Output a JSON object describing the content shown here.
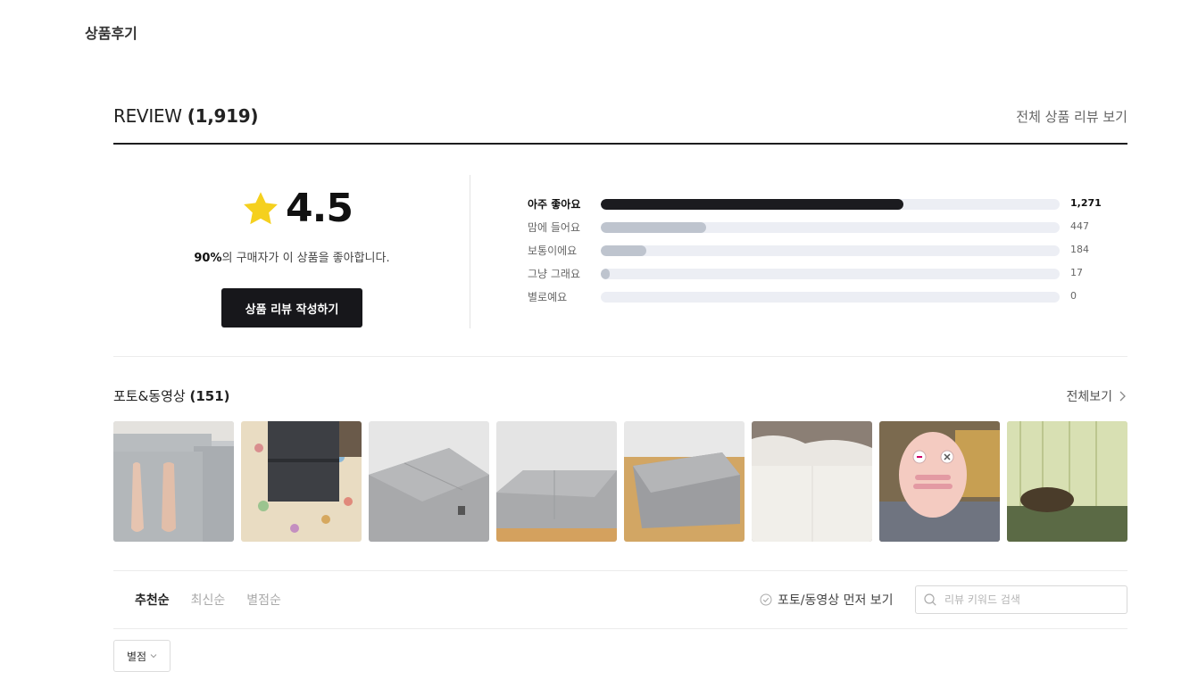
{
  "section_title": "상품후기",
  "review": {
    "title": "REVIEW",
    "count": "(1,919)",
    "all_link": "전체 상품 리뷰 보기"
  },
  "summary": {
    "score": "4.5",
    "percent": "90%",
    "satisfaction_text": "의 구매자가 이 상품을 좋아합니다.",
    "write_button": "상품 리뷰 작성하기",
    "star_color": "#f5d01e"
  },
  "distribution": [
    {
      "label": "아주 좋아요",
      "count": "1,271",
      "fraction": 0.66
    },
    {
      "label": "맘에 들어요",
      "count": "447",
      "fraction": 0.23
    },
    {
      "label": "보통이에요",
      "count": "184",
      "fraction": 0.1
    },
    {
      "label": "그냥 그래요",
      "count": "17",
      "fraction": 0.02
    },
    {
      "label": "별로예요",
      "count": "0",
      "fraction": 0.0
    }
  ],
  "photos": {
    "title": "포토&동영상",
    "count": "(151)",
    "all_link": "전체보기",
    "items": [
      {
        "name": "photo-legs-on-mattress"
      },
      {
        "name": "photo-folded-mattress-on-mat"
      },
      {
        "name": "photo-gray-mattress-1"
      },
      {
        "name": "photo-gray-mattress-2"
      },
      {
        "name": "photo-gray-mattress-3"
      },
      {
        "name": "photo-white-mattress"
      },
      {
        "name": "photo-person-on-pillow"
      },
      {
        "name": "photo-green-mattress-pillow"
      }
    ]
  },
  "sort": {
    "tabs": [
      "추천순",
      "최신순",
      "별점순"
    ],
    "active": 0,
    "photo_first": "포토/동영상 먼저 보기"
  },
  "search": {
    "placeholder": "리뷰 키워드 검색"
  },
  "filter": {
    "label": "별점"
  },
  "colors": {
    "bar_top": "#1b1b1f",
    "bar_other": "#bec4ce",
    "bar_track": "#eceef4"
  }
}
